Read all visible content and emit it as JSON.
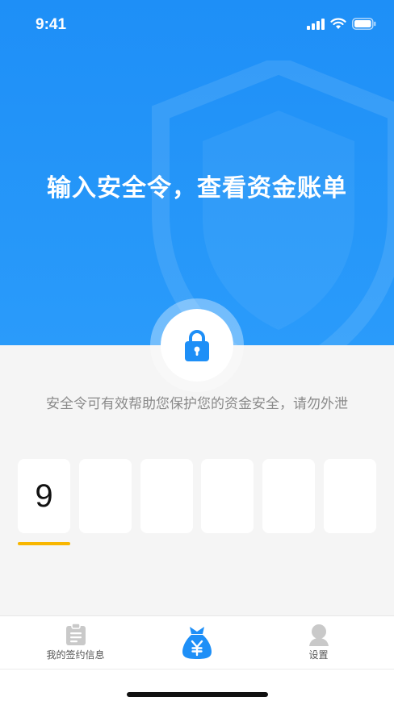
{
  "status_bar": {
    "time": "9:41"
  },
  "hero": {
    "title": "输入安全令，查看资金账单"
  },
  "hint": "安全令可有效帮助您保护您的资金安全，请勿外泄",
  "code": {
    "digits": [
      "9",
      "",
      "",
      "",
      "",
      ""
    ],
    "active_index": 0
  },
  "tabs": [
    {
      "label": "我的签约信息",
      "icon": "document-icon"
    },
    {
      "label": "",
      "icon": "money-bag-icon",
      "selected": true
    },
    {
      "label": "设置",
      "icon": "user-icon"
    }
  ],
  "colors": {
    "primary": "#1e8ff7",
    "accent": "#f8b600",
    "background": "#f5f5f5"
  }
}
